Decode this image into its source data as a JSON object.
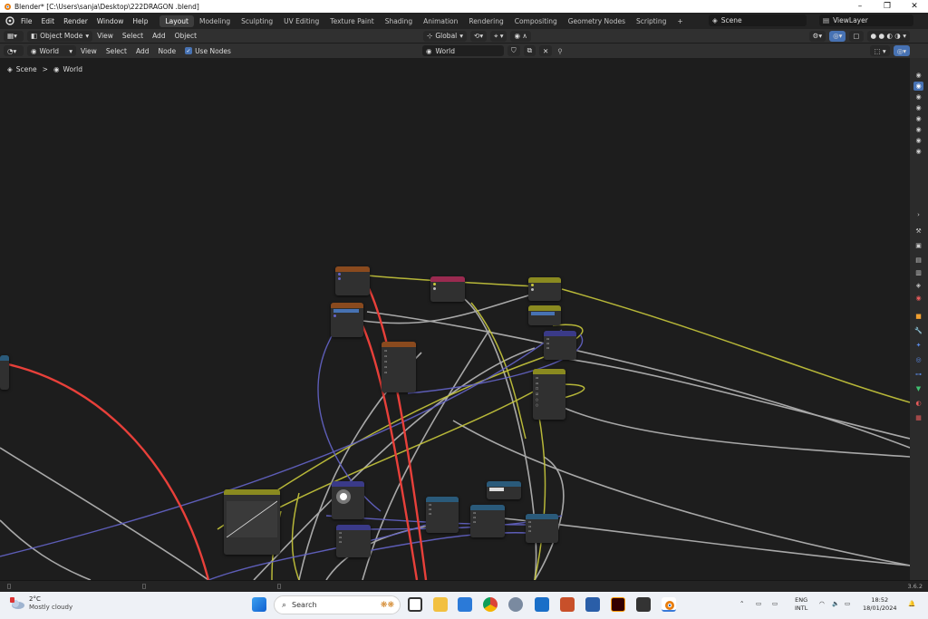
{
  "window": {
    "title": "Blender* [C:\\Users\\sanja\\Desktop\\222DRAGON .blend]",
    "minimize": "–",
    "maximize": "❐",
    "close": "✕"
  },
  "menu": [
    "File",
    "Edit",
    "Render",
    "Window",
    "Help"
  ],
  "workspaces": [
    "Layout",
    "Modeling",
    "Sculpting",
    "UV Editing",
    "Texture Paint",
    "Shading",
    "Animation",
    "Rendering",
    "Compositing",
    "Geometry Nodes",
    "Scripting",
    "+"
  ],
  "active_workspace": "Layout",
  "scene": {
    "name": "Scene",
    "view_layer": "ViewLayer"
  },
  "header": {
    "mode": "Object Mode",
    "menus": [
      "View",
      "Select",
      "Add",
      "Object"
    ],
    "transform": "Global"
  },
  "node_header": {
    "type": "World",
    "menus": [
      "View",
      "Select",
      "Add",
      "Node"
    ],
    "use_nodes": "Use Nodes",
    "datablock": "World"
  },
  "breadcrumb": {
    "scene": "Scene",
    "world": "World",
    "sep": ">"
  },
  "status": {
    "version": "3.6.2"
  },
  "taskbar": {
    "temp": "2°C",
    "weather": "Mostly cloudy",
    "search": "Search",
    "lang1": "ENG",
    "lang2": "INTL",
    "time": "18:52",
    "date": "18/01/2024"
  },
  "colors": {
    "accent": "#4772b3",
    "wire_red": "#e8403a",
    "wire_yellow": "#c8c83c",
    "wire_gray": "#b8b8b8",
    "wire_purple": "#6464c8",
    "header_color": "#7a5a28",
    "header_shader": "#2d6a3c",
    "header_texture": "#7a4a1e",
    "header_input": "#9a2a50",
    "header_vector": "#3a3a88",
    "header_converter": "#2a5a7a",
    "header_mix": "#8a8a20"
  },
  "icons": {
    "blender": "blender-logo-icon",
    "pin": "pin-icon",
    "wifi": "wifi-icon",
    "speaker": "speaker-icon",
    "battery": "battery-icon",
    "bell": "bell-icon"
  }
}
